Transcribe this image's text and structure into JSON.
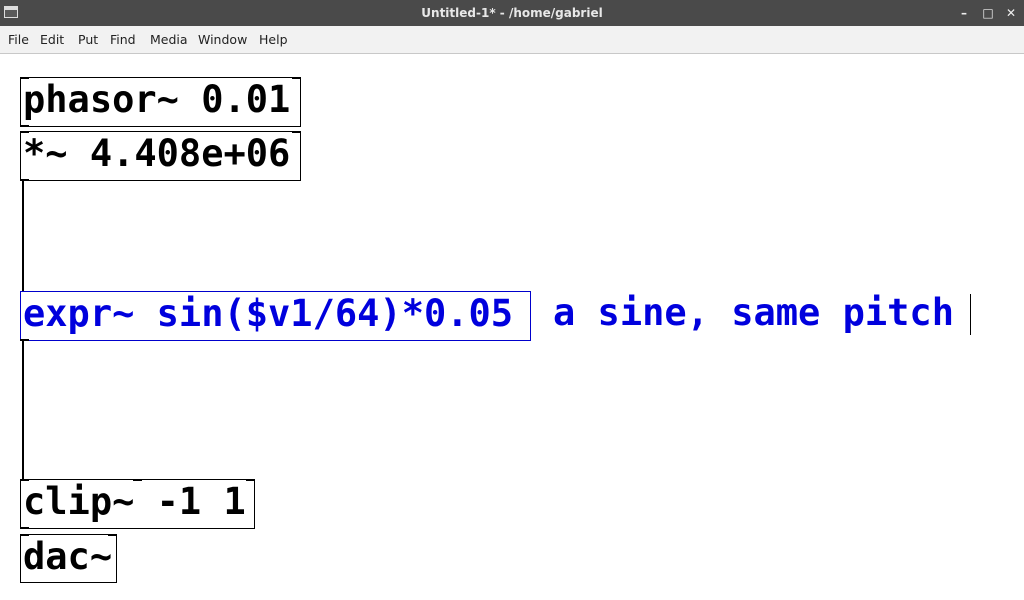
{
  "window": {
    "title": "Untitled-1* - /home/gabriel",
    "minimize_label": "–",
    "maximize_label": "□",
    "close_label": "✕"
  },
  "menu": {
    "items": [
      "File",
      "Edit",
      "Put",
      "Find",
      "Media",
      "Window",
      "Help"
    ]
  },
  "patch": {
    "objects": [
      {
        "text": "phasor~ 0.01"
      },
      {
        "text": "*~ 4.408e+06"
      },
      {
        "text": "expr~ sin($v1/64)*0.05"
      },
      {
        "text": "clip~ -1 1"
      },
      {
        "text": "dac~"
      }
    ],
    "comment": "a sine, same pitch"
  },
  "colors": {
    "selected": "#0000dd",
    "titlebar": "#4a4a4a",
    "menubar": "#f2f2f2"
  }
}
